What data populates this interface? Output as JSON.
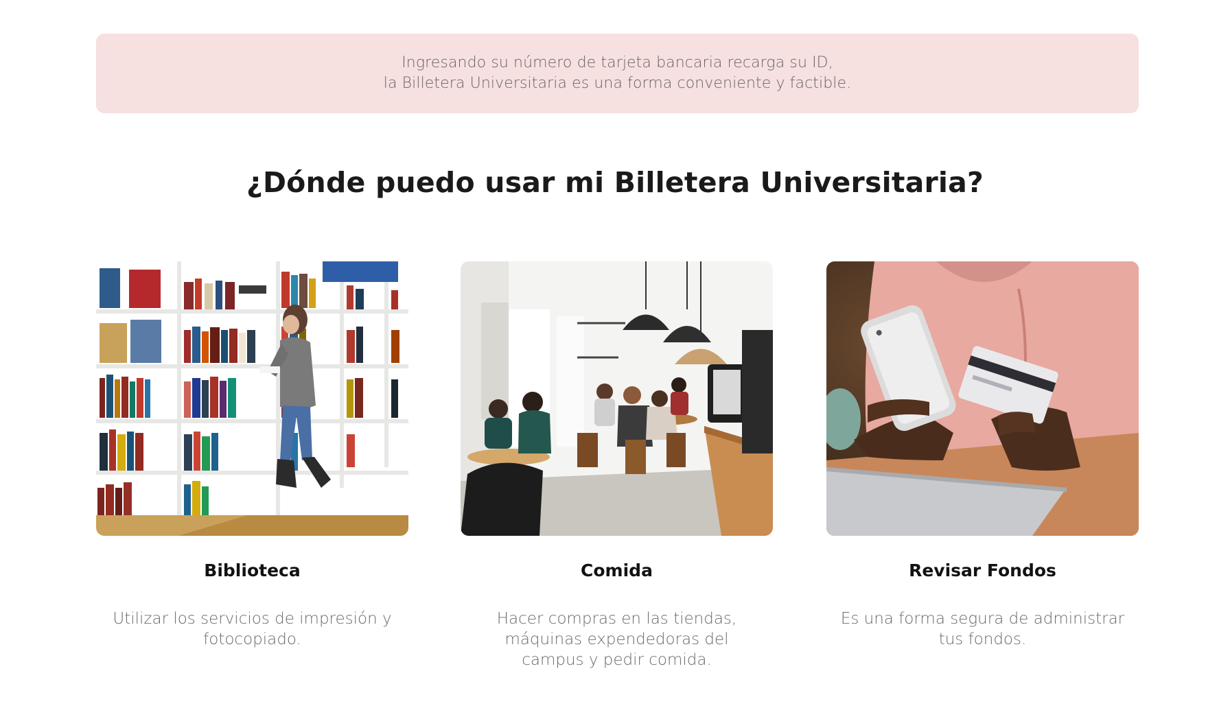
{
  "banner": {
    "line1": "Ingresando su número de tarjeta bancaria recarga su ID,",
    "line2": "la Billetera Universitaria es una forma conveniente y factible."
  },
  "section": {
    "title": "¿Dónde puedo usar mi Billetera Universitaria?"
  },
  "cards": [
    {
      "title": "Biblioteca",
      "desc_lines": [
        "Utilizar los servicios de impresión y",
        "fotocopiado."
      ]
    },
    {
      "title": "Comida",
      "desc_lines": [
        "Hacer compras en las tiendas,",
        "máquinas expendedoras del",
        "campus y pedir comida."
      ]
    },
    {
      "title": "Revisar Fondos",
      "desc_lines": [
        "Es una forma segura de administrar",
        "tus fondos."
      ]
    }
  ],
  "colors": {
    "banner_bg": "#f6e0e0",
    "banner_text": "#6d6262",
    "title_text": "#1a1a1a",
    "desc_text": "#6d6868"
  }
}
